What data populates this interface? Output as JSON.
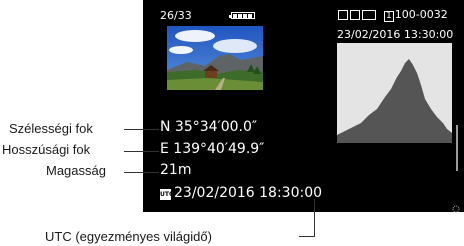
{
  "playback": {
    "counter": "26/33",
    "folder_file": "100-0032",
    "card_slot": "1",
    "datetime": "23/02/2016 13:30:00",
    "icons": [
      "battery-icon",
      "picture-style-icon",
      "white-balance-icon",
      "protect-icon",
      "card-icon"
    ]
  },
  "gps": {
    "latitude": "N  35°34′00.0″",
    "longitude": "E 139°40′49.9″",
    "altitude": "21m",
    "utc_badge": "UTC",
    "utc_datetime": "23/02/2016  18:30:00"
  },
  "labels": {
    "latitude": "Szélességi fok",
    "longitude": "Hosszúsági fok",
    "altitude": "Magasság",
    "utc": "UTC (egyezményes világidő)"
  },
  "colors": {
    "lcd_background": "#000000",
    "histogram_bg": "#e4e4e4",
    "histogram_fill": "#555555"
  }
}
